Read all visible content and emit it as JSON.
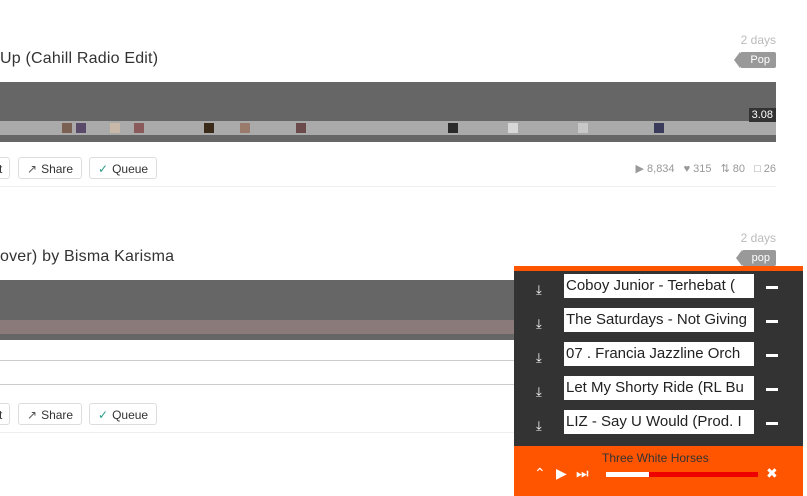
{
  "tracks": [
    {
      "title": "Up (Cahill Radio Edit)",
      "age": "2 days",
      "tag": "Pop",
      "timer": "3.08",
      "actions": {
        "share": "Share",
        "queue": "Queue"
      },
      "stats": {
        "plays": "8,834",
        "likes": "315",
        "reposts": "80",
        "comments": "26"
      }
    },
    {
      "title": "over) by Bisma Karisma",
      "age": "2 days",
      "tag": "pop",
      "actions": {
        "share": "Share",
        "queue": "Queue"
      }
    }
  ],
  "player": {
    "queue": [
      "Coboy Junior - Terhebat (",
      "The Saturdays - Not Giving",
      "07 . Francia Jazzline Orch",
      "Let My Shorty Ride (RL Bu",
      "LIZ - Say U Would (Prod. I"
    ],
    "now_playing": "Three White Horses",
    "progress": 0.28,
    "colors": {
      "accent": "#ff5500",
      "bg": "#333333"
    }
  }
}
